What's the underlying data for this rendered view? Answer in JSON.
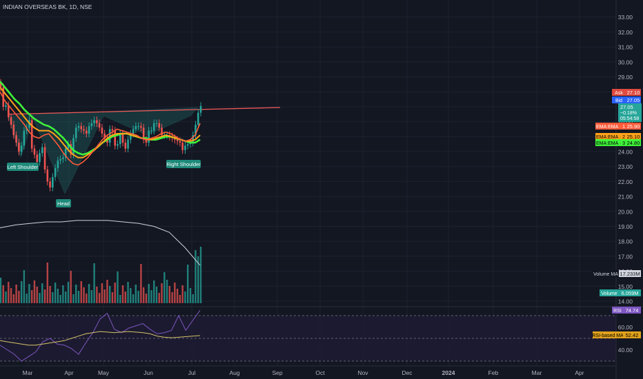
{
  "symbol": {
    "title": "INDIAN OVERSEAS BK, 1D, NSE"
  },
  "colors": {
    "background": "#131722",
    "grid": "#1e2230",
    "bull": "#26a69a",
    "bear": "#ef5350",
    "ema1": "#ff5b39",
    "ema2": "#ffa31a",
    "ema3": "#3ff23a",
    "neckline": "#f05a5a",
    "ma_line": "#d1d4dc",
    "rsi_line": "#7e57c2",
    "rsi_ma": "#d6c46a",
    "rsi_band": "#1f1b33",
    "pattern_fill": "#1f6f6a",
    "label_bg": "#1e8a7a"
  },
  "price_axis": {
    "ticks": [
      "33.00",
      "32.00",
      "31.00",
      "30.00",
      "29.00",
      "28.00",
      "27.00",
      "26.00",
      "25.00",
      "24.00",
      "23.00",
      "22.00",
      "21.00",
      "20.00",
      "19.00",
      "18.00",
      "17.00",
      "16.00",
      "15.00",
      "14.00"
    ]
  },
  "rsi_axis": {
    "ticks": [
      "60.00",
      "40.00"
    ]
  },
  "time_axis": {
    "labels": [
      "Mar",
      "Apr",
      "May",
      "Jun",
      "Jul",
      "Aug",
      "Sep",
      "Oct",
      "Nov",
      "Dec",
      "2024",
      "Feb",
      "Mar",
      "Apr"
    ]
  },
  "badges": {
    "ask": {
      "label": "Ask",
      "value": "27.10"
    },
    "bid": {
      "label": "Bid",
      "value": "27.05"
    },
    "last": {
      "price": "27.05",
      "change": "−0.18%",
      "countdown": "05:54:58"
    },
    "ema1": {
      "label": "EMA:EMA · 1",
      "value": "25.90"
    },
    "ema2": {
      "label": "EMA:EMA · 2",
      "value": "25.10"
    },
    "ema3": {
      "label": "EMA:EMA · 3",
      "value": "24.80"
    },
    "volume_ma": {
      "label": "Volume MA",
      "value": "17.233M"
    },
    "volume": {
      "label": "Volume",
      "value": "6.059M"
    },
    "rsi": {
      "label": "RSI",
      "value": "74.74"
    },
    "rsi_ma": {
      "label": "RSI-based MA",
      "value": "52.42"
    }
  },
  "annotations": {
    "left_shoulder": "Left Shoulder",
    "head": "Head",
    "right_shoulder": "Right Shoulder"
  },
  "chart_data": {
    "type": "candlestick",
    "title": "INDIAN OVERSEAS BK, 1D, NSE",
    "x_range": [
      "2023-02-14",
      "2024-04-20"
    ],
    "price_ylim": [
      13.9,
      33.6
    ],
    "series": [
      {
        "name": "EMA:EMA · 1",
        "values": [
          28.0,
          27.4,
          27.0,
          26.6,
          26.2,
          25.8,
          25.3,
          25.0,
          24.9,
          25.1,
          25.2,
          24.8,
          24.4,
          23.9,
          23.5,
          23.2,
          23.1,
          23.3,
          23.6,
          24.0,
          24.4,
          24.8,
          25.1,
          25.3,
          25.5,
          25.4,
          25.3,
          25.2,
          25.1,
          24.9,
          24.8,
          24.9,
          25.0,
          25.2,
          25.3,
          25.2,
          25.0,
          24.8,
          24.7,
          24.8,
          25.1,
          25.9
        ]
      },
      {
        "name": "EMA:EMA · 2",
        "values": [
          28.3,
          27.9,
          27.5,
          27.1,
          26.7,
          26.3,
          25.9,
          25.6,
          25.4,
          25.4,
          25.4,
          25.2,
          24.9,
          24.5,
          24.1,
          23.8,
          23.6,
          23.6,
          23.8,
          24.0,
          24.3,
          24.6,
          24.9,
          25.1,
          25.2,
          25.2,
          25.2,
          25.1,
          25.0,
          24.9,
          24.8,
          24.8,
          24.9,
          25.0,
          25.1,
          25.0,
          24.9,
          24.8,
          24.7,
          24.7,
          24.8,
          25.1
        ]
      },
      {
        "name": "EMA:EMA · 3",
        "values": [
          28.7,
          28.3,
          27.9,
          27.5,
          27.2,
          26.8,
          26.5,
          26.2,
          26.0,
          25.8,
          25.7,
          25.5,
          25.2,
          24.9,
          24.5,
          24.1,
          23.9,
          23.8,
          23.9,
          24.1,
          24.3,
          24.6,
          24.8,
          25.0,
          25.1,
          25.2,
          25.2,
          25.1,
          25.0,
          24.9,
          24.9,
          24.8,
          24.8,
          24.9,
          25.0,
          25.0,
          24.9,
          24.8,
          24.7,
          24.6,
          24.6,
          24.8
        ]
      }
    ],
    "closes": [
      28.3,
      27.0,
      27.1,
      26.3,
      25.8,
      25.1,
      24.6,
      24.0,
      24.4,
      25.4,
      25.6,
      26.1,
      24.2,
      23.8,
      23.3,
      23.9,
      24.3,
      22.8,
      22.0,
      21.6,
      22.3,
      22.9,
      23.4,
      23.5,
      23.6,
      24.2,
      24.5,
      23.8,
      24.9,
      25.6,
      25.7,
      25.5,
      25.4,
      25.2,
      25.7,
      25.9,
      26.1,
      25.9,
      25.6,
      25.2,
      24.9,
      24.6,
      25.5,
      25.4,
      24.4,
      24.5,
      25.2,
      24.6,
      24.2,
      24.8,
      25.2,
      25.5,
      25.7,
      25.7,
      25.6,
      24.8,
      24.6,
      25.4,
      25.4,
      25.9,
      25.9,
      25.6,
      25.1,
      25.1,
      25.1,
      25.0,
      24.9,
      24.8,
      24.7,
      24.6,
      24.1,
      24.4,
      24.5,
      24.6,
      25.1,
      25.8,
      26.6,
      27.05
    ],
    "neckline": {
      "from": {
        "date": "2023-02-20",
        "price": 26.5
      },
      "to": {
        "date": "2023-09-05",
        "price": 26.95
      }
    },
    "volume_ma": [
      18.9,
      19.1,
      19.2,
      19.3,
      19.3,
      19.4,
      19.4,
      19.4,
      19.3,
      19.2,
      19.0,
      18.6,
      17.6,
      16.4
    ],
    "rsi": [
      44,
      40,
      36,
      30,
      34,
      38,
      47,
      50,
      45,
      44,
      41,
      36,
      46,
      55,
      67,
      72,
      58,
      55,
      59,
      61,
      63,
      58,
      54,
      55,
      57,
      70,
      57,
      66,
      74.74
    ],
    "rsi_ma": [
      48,
      47,
      46,
      45,
      44,
      44,
      45,
      46,
      47,
      48,
      50,
      52,
      54,
      55,
      56,
      55.5,
      55,
      55.5,
      56,
      55.5,
      55,
      54,
      52,
      51,
      50.5,
      51,
      51.5,
      52,
      52.42
    ],
    "rsi_guides": [
      70,
      50,
      30
    ]
  }
}
